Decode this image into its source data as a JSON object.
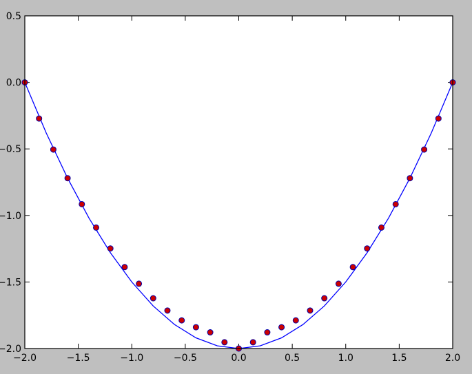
{
  "chart_data": {
    "type": "line",
    "title": "",
    "xlabel": "",
    "ylabel": "",
    "xlim": [
      -2.0,
      2.0
    ],
    "ylim": [
      -2.0,
      0.5
    ],
    "grid": false,
    "x_ticks": [
      "−2.0",
      "−1.5",
      "−1.0",
      "−0.5",
      "0.0",
      "0.5",
      "1.0",
      "1.5",
      "2.0"
    ],
    "y_ticks": [
      "0.5",
      "0.0",
      "−0.5",
      "−1.0",
      "−1.5",
      "−2.0"
    ],
    "series": [
      {
        "style": "line",
        "color": "#0000ff",
        "x": [
          -2.0,
          -1.8,
          -1.6,
          -1.4,
          -1.2,
          -1.0,
          -0.8,
          -0.6,
          -0.4,
          -0.2,
          0.0,
          0.2,
          0.4,
          0.6,
          0.8,
          1.0,
          1.2,
          1.4,
          1.6,
          1.8,
          2.0
        ],
        "y": [
          0.0,
          -0.38,
          -0.72,
          -1.02,
          -1.28,
          -1.5,
          -1.68,
          -1.82,
          -1.92,
          -1.98,
          -2.0,
          -1.98,
          -1.92,
          -1.82,
          -1.68,
          -1.5,
          -1.28,
          -1.02,
          -0.72,
          -0.38,
          0.0
        ]
      },
      {
        "style": "markers",
        "color": "#cc0000",
        "edge_color": "#0000aa",
        "x": [
          -2.0,
          -1.8667,
          -1.7333,
          -1.6,
          -1.4667,
          -1.3333,
          -1.2,
          -1.0667,
          -0.9333,
          -0.8,
          -0.6667,
          -0.5333,
          -0.4,
          -0.2667,
          -0.1333,
          0.0,
          0.1333,
          0.2667,
          0.4,
          0.5333,
          0.6667,
          0.8,
          0.9333,
          1.0667,
          1.2,
          1.3333,
          1.4667,
          1.6,
          1.7333,
          1.8667,
          2.0
        ],
        "y": [
          0.0,
          -0.2716,
          -0.5047,
          -0.72,
          -0.9156,
          -1.0911,
          -1.248,
          -1.3882,
          -1.5129,
          -1.6222,
          -1.7144,
          -1.7884,
          -1.84,
          -1.8784,
          -1.9529,
          -2.0,
          -1.9529,
          -1.8784,
          -1.84,
          -1.7884,
          -1.7144,
          -1.6222,
          -1.5129,
          -1.3882,
          -1.248,
          -1.0911,
          -0.9156,
          -0.72,
          -0.5047,
          -0.2716,
          0.0
        ]
      }
    ]
  }
}
